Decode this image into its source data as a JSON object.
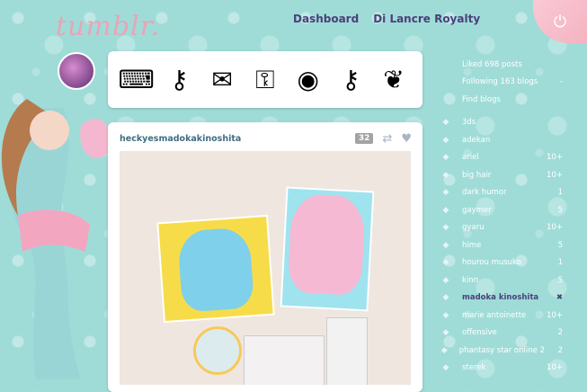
{
  "app": {
    "logo": "tumblr."
  },
  "topnav": {
    "dashboard": "Dashboard",
    "blog": "Di Lancre Royalty"
  },
  "banner": {
    "items": [
      "typewriter-icon",
      "key-icon",
      "envelope-icon",
      "key-icon",
      "cameo-icon",
      "key-icon",
      "bow-icon"
    ]
  },
  "post": {
    "user": "heckyesmadokakinoshita",
    "note_count": "32",
    "icons": [
      "reblog-icon",
      "heart-icon"
    ]
  },
  "sidebar": {
    "links": [
      {
        "label": "Liked 698 posts",
        "count": ""
      },
      {
        "label": "Following 163 blogs",
        "count": "-"
      },
      {
        "label": "Find blogs",
        "count": ""
      }
    ],
    "tags": [
      {
        "label": "3ds",
        "count": ""
      },
      {
        "label": "adekan",
        "count": ""
      },
      {
        "label": "ariel",
        "count": "10+"
      },
      {
        "label": "big hair",
        "count": "10+"
      },
      {
        "label": "dark humor",
        "count": "1"
      },
      {
        "label": "gaymer",
        "count": "5"
      },
      {
        "label": "gyaru",
        "count": "10+"
      },
      {
        "label": "hime",
        "count": "5"
      },
      {
        "label": "hourou musuko",
        "count": "1"
      },
      {
        "label": "kinn",
        "count": "5"
      },
      {
        "label": "madoka kinoshita",
        "count": "✖",
        "active": true
      },
      {
        "label": "marie antoinette",
        "count": "10+"
      },
      {
        "label": "offensive",
        "count": "2"
      },
      {
        "label": "phantasy star online 2",
        "count": "2"
      },
      {
        "label": "sterek",
        "count": "10+"
      }
    ]
  }
}
